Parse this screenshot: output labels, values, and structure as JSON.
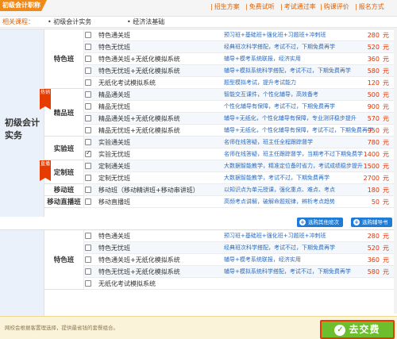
{
  "header": {
    "active_tab": "初级会计职称",
    "links": [
      "招生方案",
      "免费试听",
      "考试通过率",
      "购课评价",
      "报名方式"
    ]
  },
  "related": {
    "label": "相关课程：",
    "links": [
      "初级会计实务",
      "经济法基础"
    ]
  },
  "groups": [
    {
      "title": "初级会计实务",
      "categories": [
        {
          "name": "特色班",
          "badge": ""
        },
        {
          "name": "精品班",
          "badge": "热销"
        },
        {
          "name": "实验班",
          "badge": ""
        },
        {
          "name": "定制班",
          "badge": "直播"
        },
        {
          "name": "移动班",
          "badge": ""
        },
        {
          "name": "移动直播班",
          "badge": ""
        }
      ],
      "rows": [
        {
          "name": "特色通关班",
          "desc": "预习班+基础班+强化班+习题班+冲刺班",
          "price": "280",
          "unit": "元",
          "checked": false
        },
        {
          "name": "特色无忧班",
          "desc": "经典班次科学搭配，考试不过，下期免费再学",
          "price": "520",
          "unit": "元",
          "checked": false
        },
        {
          "name": "特色通关班+无纸化模拟系统",
          "desc": "辅导+模考系统联报，经济实用",
          "price": "360",
          "unit": "元",
          "checked": false
        },
        {
          "name": "特色无忧班+无纸化模拟系统",
          "desc": "辅导+模拟系统科学搭配，考试不过，下期免费再学",
          "price": "580",
          "unit": "元",
          "checked": false
        },
        {
          "name": "无纸化考试模拟系统",
          "desc": "题型模拟考试，提升考试能力",
          "price": "120",
          "unit": "元",
          "checked": false
        },
        {
          "name": "精品通关班",
          "desc": "智能交互课件，个性化辅导，高效备考",
          "price": "500",
          "unit": "元",
          "checked": false
        },
        {
          "name": "精品无忧班",
          "desc": "个性化辅导有保障，考试不过，下期免费再学",
          "price": "900",
          "unit": "元",
          "checked": false
        },
        {
          "name": "精品通关班+无纸化模拟系统",
          "desc": "辅导+无纸化，个性化辅导有保障，专业测评稳步提升",
          "price": "570",
          "unit": "元",
          "checked": false
        },
        {
          "name": "精品无忧班+无纸化模拟系统",
          "desc": "辅导+无纸化，个性化辅导有保障，考试不过，下期免费再学",
          "price": "950",
          "unit": "元",
          "checked": false
        },
        {
          "name": "实验通关班",
          "desc": "名师在线答疑，班主任全程跟踪督学",
          "price": "780",
          "unit": "元",
          "checked": false
        },
        {
          "name": "实验无忧班",
          "desc": "名师在线答疑，班主任跟踪督学，当期考不过下期免费学",
          "price": "1400",
          "unit": "元",
          "checked": true
        },
        {
          "name": "定制通关班",
          "desc": "大数据智能教学，精准定位备时省力，考试成绩稳步提升",
          "price": "1500",
          "unit": "元",
          "checked": false
        },
        {
          "name": "定制无忧班",
          "desc": "大数据智能教学，考试不过，下期免费再学",
          "price": "2700",
          "unit": "元",
          "checked": false
        },
        {
          "name": "移动班（移动精讲班+移动串讲班）",
          "desc": "以知识点为单元授课，强化重点、难点、考点",
          "price": "180",
          "unit": "元",
          "checked": false
        },
        {
          "name": "移动直播班",
          "desc": "高频考点讲解，破解命题规律，辨析考点趋势",
          "price": "50",
          "unit": "元",
          "checked": false
        }
      ],
      "buttons": [
        "选购其他班次",
        "选购辅导书"
      ]
    },
    {
      "title": "",
      "categories": [
        {
          "name": "特色班",
          "badge": ""
        }
      ],
      "rows": [
        {
          "name": "特色通关班",
          "desc": "预习班+基础班+强化班+习题班+冲刺班",
          "price": "280",
          "unit": "元",
          "checked": false
        },
        {
          "name": "特色无忧班",
          "desc": "经典班次科学搭配，考试不过，下期免费再学",
          "price": "520",
          "unit": "元",
          "checked": false
        },
        {
          "name": "特色通关班+无纸化模拟系统",
          "desc": "辅导+模考系统联报，经济实用",
          "price": "360",
          "unit": "元",
          "checked": false
        },
        {
          "name": "特色无忧班+无纸化模拟系统",
          "desc": "辅导+模拟系统科学搭配，考试不过，下期免费再学",
          "price": "580",
          "unit": "元",
          "checked": false
        },
        {
          "name": "无纸化考试模拟系统",
          "desc": "",
          "price": "",
          "unit": "",
          "checked": false
        }
      ]
    }
  ],
  "footer": {
    "note": "网校会根据客置理选择，提供最省钱的套餐组合。",
    "pay_label": "去交费"
  },
  "colors": {
    "accent": "#f08a16",
    "price": "#e03000",
    "link": "#2a6ac0",
    "pay": "#6dbe2c"
  }
}
